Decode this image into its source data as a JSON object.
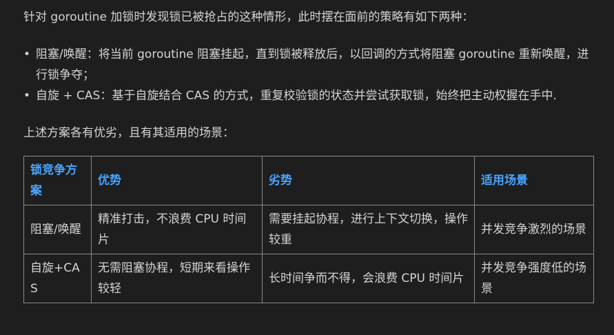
{
  "intro": "针对 goroutine 加锁时发现锁已被抢占的这种情形，此时摆在面前的策略有如下两种：",
  "bullets": [
    {
      "marker": "•",
      "text": "阻塞/唤醒：将当前 goroutine 阻塞挂起，直到锁被释放后，以回调的方式将阻塞 goroutine 重新唤醒，进行锁争夺；"
    },
    {
      "marker": "•",
      "text": "自旋 + CAS：基于自旋结合 CAS 的方式，重复校验锁的状态并尝试获取锁，始终把主动权握在手中."
    }
  ],
  "summary": "上述方案各有优劣，且有其适用的场景：",
  "table": {
    "headers": [
      "锁竞争方案",
      "优势",
      "劣势",
      "适用场景"
    ],
    "rows": [
      [
        "阻塞/唤醒",
        "精准打击，不浪费 CPU 时间片",
        "需要挂起协程，进行上下文切换，操作较重",
        "并发竞争激烈的场景"
      ],
      [
        "自旋+CAS",
        "无需阻塞协程，短期来看操作较轻",
        "长时间争而不得，会浪费 CPU 时间片",
        "并发竞争强度低的场景"
      ]
    ]
  },
  "colors": {
    "background": "#1e1e1e",
    "text": "#d4d4d4",
    "header_text": "#4aa3ff",
    "border": "#8a8a8a"
  }
}
